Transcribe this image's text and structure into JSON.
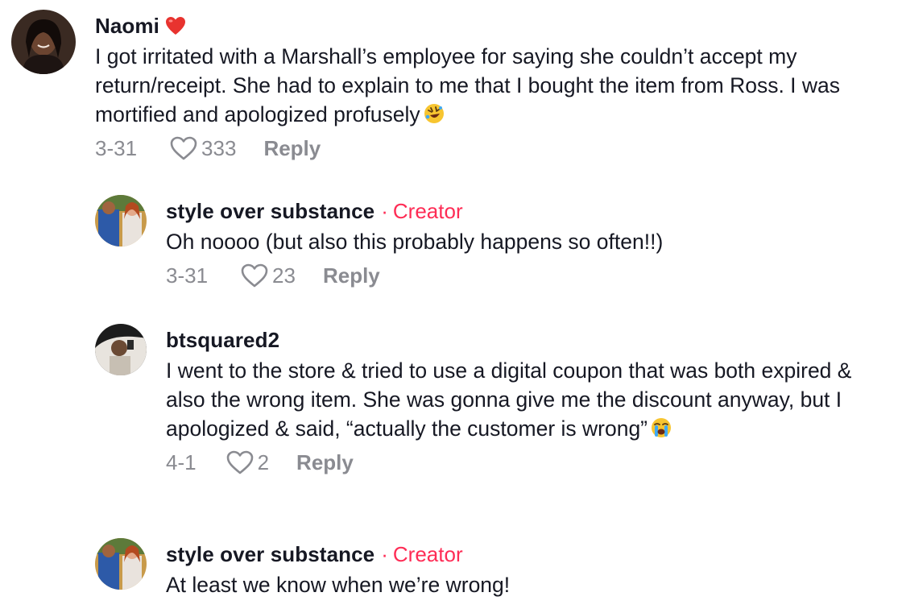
{
  "comments": [
    {
      "username": "Naomi",
      "has_heart": true,
      "creator": false,
      "text": "I got irritated with a Marshall’s employee for saying she couldn’t accept my return/receipt. She had to explain to me that I bought the item from Ross. I was mortified and apologized profusely",
      "emoji": "rolling-on-floor-laughing",
      "date": "3-31",
      "likes": "333",
      "reply_label": "Reply"
    },
    {
      "username": "style over substance",
      "creator": true,
      "creator_dot": "·",
      "creator_label": "Creator",
      "text": "Oh noooo (but also this probably happens so often!!)",
      "date": "3-31",
      "likes": "23",
      "reply_label": "Reply"
    },
    {
      "username": "btsquared2",
      "creator": false,
      "text": "I went to the store & tried to use a digital coupon that was both expired & also the wrong item. She was gonna give me the discount anyway, but I apologized & said, “actually the customer is wrong”",
      "emoji": "loudly-crying-face",
      "date": "4-1",
      "likes": "2",
      "reply_label": "Reply"
    },
    {
      "username": "style over substance",
      "creator": true,
      "creator_dot": "·",
      "creator_label": "Creator",
      "text": "At least we know when we’re wrong!"
    }
  ],
  "colors": {
    "creator_accent": "#fe2c55",
    "meta_gray": "#8a8b91",
    "text": "#161823"
  },
  "icons": {
    "like": "heart-outline-icon",
    "name_heart": "red-heart-emoji"
  }
}
